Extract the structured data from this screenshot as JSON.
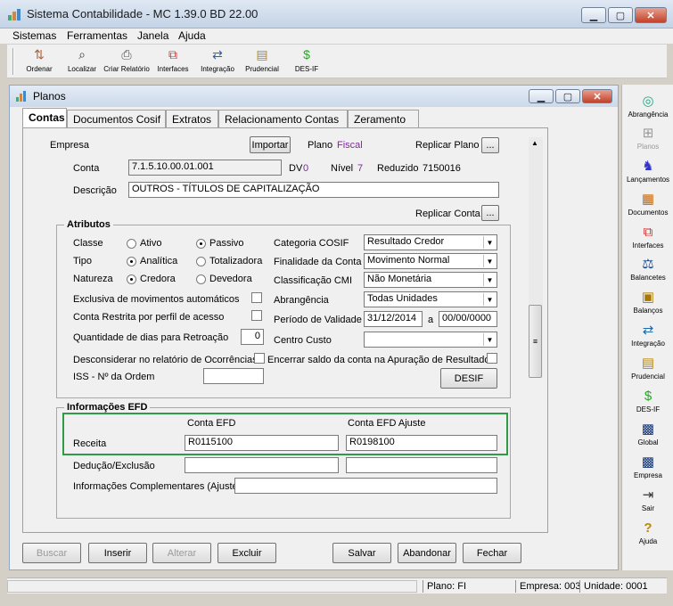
{
  "app": {
    "title": "Sistema Contabilidade  -  MC 1.39.0 BD 22.00"
  },
  "menu": [
    "Sistemas",
    "Ferramentas",
    "Janela",
    "Ajuda"
  ],
  "toolbar": [
    {
      "label": "Ordenar",
      "icon": "sort-icon"
    },
    {
      "label": "Localizar",
      "icon": "find-icon"
    },
    {
      "label": "Criar Relatório",
      "icon": "printer-icon"
    },
    {
      "label": "Interfaces",
      "icon": "interfaces-icon"
    },
    {
      "label": "Integração",
      "icon": "integration-icon"
    },
    {
      "label": "Prudencial",
      "icon": "book-icon"
    },
    {
      "label": "DES-IF",
      "icon": "money-bag-icon"
    }
  ],
  "sidebar": [
    {
      "label": "Abrangência",
      "icon": "globe-icon"
    },
    {
      "label": "Planos",
      "icon": "tree-icon"
    },
    {
      "label": "Lançamentos",
      "icon": "runner-icon"
    },
    {
      "label": "Documentos",
      "icon": "documents-icon"
    },
    {
      "label": "Interfaces",
      "icon": "interfaces-icon"
    },
    {
      "label": "Balancetes",
      "icon": "scales-icon"
    },
    {
      "label": "Balanços",
      "icon": "calculator-icon"
    },
    {
      "label": "Integração",
      "icon": "integration-icon"
    },
    {
      "label": "Prudencial",
      "icon": "book-icon"
    },
    {
      "label": "DES-IF",
      "icon": "money-bag-icon"
    },
    {
      "label": "Global",
      "icon": "grid-icon"
    },
    {
      "label": "Empresa",
      "icon": "company-icon"
    },
    {
      "label": "Sair",
      "icon": "exit-icon"
    },
    {
      "label": "Ajuda",
      "icon": "help-icon"
    }
  ],
  "window": {
    "title": "Planos"
  },
  "tabs": [
    "Contas",
    "Documentos Cosif",
    "Extratos",
    "Relacionamento Contas",
    "Zeramento"
  ],
  "form": {
    "empresa_label": "Empresa",
    "importar": "Importar",
    "plano_label": "Plano",
    "plano_value": "Fiscal",
    "replicar_plano": "Replicar Plano",
    "ellipsis": "...",
    "conta_label": "Conta",
    "conta_value": "7.1.5.10.00.01.001",
    "dv_label": "DV",
    "dv_value": "0",
    "nivel_label": "Nível",
    "nivel_value": "7",
    "reduzido_label": "Reduzido",
    "reduzido_value": "7150016",
    "descricao_label": "Descrição",
    "descricao_value": "OUTROS - TÍTULOS DE CAPITALIZAÇÃO",
    "replicar_conta": "Replicar Conta"
  },
  "atributos": {
    "title": "Atributos",
    "classe_label": "Classe",
    "ativo": "Ativo",
    "passivo": "Passivo",
    "tipo_label": "Tipo",
    "analitica": "Analítica",
    "totalizadora": "Totalizadora",
    "natureza_label": "Natureza",
    "credora": "Credora",
    "devedora": "Devedora",
    "categoria_label": "Categoria COSIF",
    "categoria_value": "Resultado Credor",
    "finalidade_label": "Finalidade da Conta",
    "finalidade_value": "Movimento Normal",
    "classificacao_label": "Classificação CMI",
    "classificacao_value": "Não Monetária",
    "abrangencia_label": "Abrangência",
    "abrangencia_value": "Todas Unidades",
    "periodo_label": "Período de Validade",
    "periodo_inicio": "31/12/2014",
    "periodo_sep": "a",
    "periodo_fim": "00/00/0000",
    "centro_label": "Centro Custo",
    "centro_value": "",
    "exclusiva_label": "Exclusiva de movimentos automáticos",
    "restrita_label": "Conta Restrita por perfil de acesso",
    "qtd_label": "Quantidade de dias para Retroação",
    "qtd_value": "0",
    "desconsiderar_label": "Desconsiderar no relatório de Ocorrências",
    "encerrar_label": "Encerrar saldo da conta na Apuração de Resultado",
    "iss_label": "ISS - Nº da Ordem",
    "iss_value": "",
    "desif": "DESIF"
  },
  "efd": {
    "title": "Informações EFD",
    "conta_efd": "Conta EFD",
    "conta_efd_ajuste": "Conta EFD Ajuste",
    "receita_label": "Receita",
    "receita_efd": "R0115100",
    "receita_ajuste": "R0198100",
    "deducao_label": "Dedução/Exclusão",
    "deducao_efd": "",
    "deducao_ajuste": "",
    "info_label": "Informações Complementares (Ajuste)",
    "info_value": ""
  },
  "buttons": {
    "buscar": "Buscar",
    "inserir": "Inserir",
    "alterar": "Alterar",
    "excluir": "Excluir",
    "salvar": "Salvar",
    "abandonar": "Abandonar",
    "fechar": "Fechar"
  },
  "status": {
    "plano": "Plano:   FI",
    "empresa": "Empresa: 003",
    "unidade": "Unidade: 0001"
  },
  "colors": {
    "highlight": "#2e9a4a",
    "accent": "#7a2a9a"
  }
}
